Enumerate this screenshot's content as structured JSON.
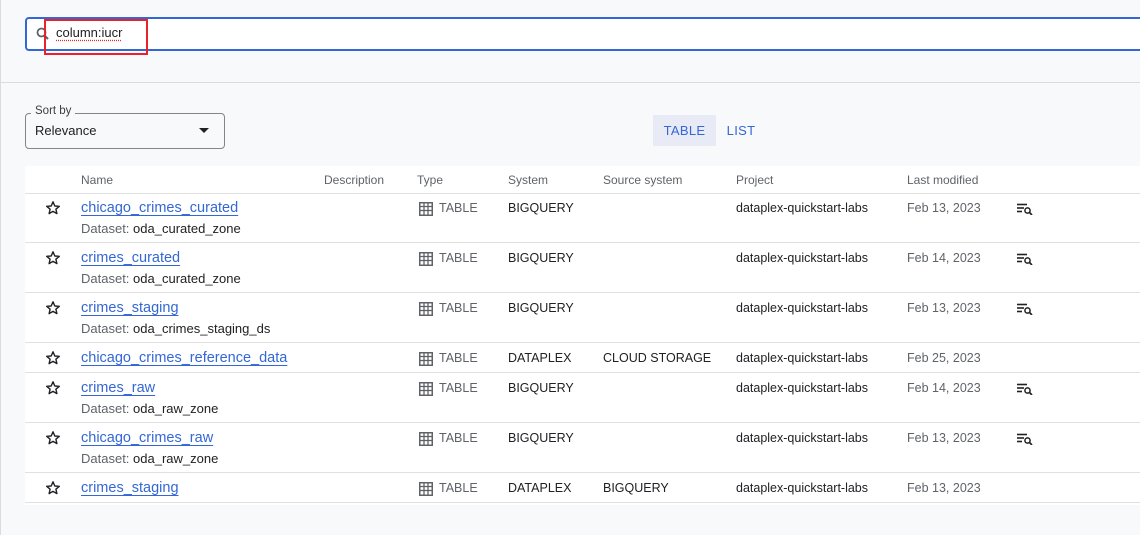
{
  "search": {
    "value": "column:iucr"
  },
  "sort": {
    "label": "Sort by",
    "value": "Relevance"
  },
  "view_toggle": {
    "table": "TABLE",
    "list": "LIST"
  },
  "colors": {
    "accent": "#3367d6",
    "highlight": "#e8212b"
  },
  "table": {
    "headers": {
      "name": "Name",
      "description": "Description",
      "type": "Type",
      "system": "System",
      "source_system": "Source system",
      "project": "Project",
      "last_modified": "Last modified"
    },
    "dataset_prefix": "Dataset:",
    "rows": [
      {
        "name": "chicago_crimes_curated",
        "dataset": "oda_curated_zone",
        "type": "TABLE",
        "system": "BIGQUERY",
        "source_system": "",
        "project": "dataplex-quickstart-labs",
        "last_modified": "Feb 13, 2023",
        "profile_icon": true
      },
      {
        "name": "crimes_curated",
        "dataset": "oda_curated_zone",
        "type": "TABLE",
        "system": "BIGQUERY",
        "source_system": "",
        "project": "dataplex-quickstart-labs",
        "last_modified": "Feb 14, 2023",
        "profile_icon": true
      },
      {
        "name": "crimes_staging",
        "dataset": "oda_crimes_staging_ds",
        "type": "TABLE",
        "system": "BIGQUERY",
        "source_system": "",
        "project": "dataplex-quickstart-labs",
        "last_modified": "Feb 13, 2023",
        "profile_icon": true
      },
      {
        "name": "chicago_crimes_reference_data",
        "dataset": "",
        "type": "TABLE",
        "system": "DATAPLEX",
        "source_system": "CLOUD STORAGE",
        "project": "dataplex-quickstart-labs",
        "last_modified": "Feb 25, 2023",
        "profile_icon": false
      },
      {
        "name": "crimes_raw",
        "dataset": "oda_raw_zone",
        "type": "TABLE",
        "system": "BIGQUERY",
        "source_system": "",
        "project": "dataplex-quickstart-labs",
        "last_modified": "Feb 14, 2023",
        "profile_icon": true
      },
      {
        "name": "chicago_crimes_raw",
        "dataset": "oda_raw_zone",
        "type": "TABLE",
        "system": "BIGQUERY",
        "source_system": "",
        "project": "dataplex-quickstart-labs",
        "last_modified": "Feb 13, 2023",
        "profile_icon": true
      },
      {
        "name": "crimes_staging",
        "dataset": "",
        "type": "TABLE",
        "system": "DATAPLEX",
        "source_system": "BIGQUERY",
        "project": "dataplex-quickstart-labs",
        "last_modified": "Feb 13, 2023",
        "profile_icon": false
      }
    ]
  }
}
